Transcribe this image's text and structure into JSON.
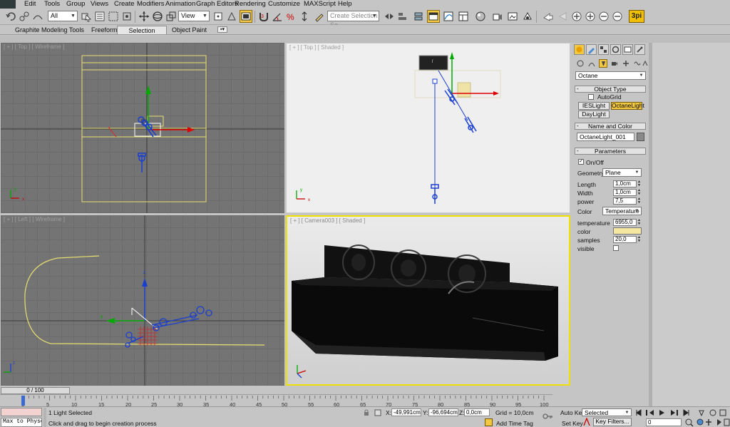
{
  "menu": {
    "items": [
      "Edit",
      "Tools",
      "Group",
      "Views",
      "Create",
      "Modifiers",
      "Animation",
      "Graph Editors",
      "Rendering",
      "Customize",
      "MAXScript",
      "Help"
    ]
  },
  "toolbar": {
    "selection_filter": "All",
    "ref_coord": "View",
    "named_selection_placeholder": "Create Selection Se",
    "logo": "3pi"
  },
  "ribbon": {
    "tabs": [
      "Graphite Modeling Tools",
      "Freeform",
      "Selection",
      "Object Paint"
    ],
    "active_tab": "Selection"
  },
  "viewports": {
    "top_left": "[ + ] [ Top ] [ Wireframe ]",
    "top_right": "[ + ] [ Top ] [ Shaded ]",
    "bottom_left": "[ + ] [ Left ] [ Wireframe ]",
    "bottom_right": "[ + ] [ Camera003 ] [ Shaded ]"
  },
  "command_panel": {
    "category_dropdown": "Octane",
    "object_type": {
      "title": "Object Type",
      "autogrid_label": "AutoGrid",
      "buttons": [
        "IESLight",
        "OctaneLight",
        "DayLight"
      ],
      "active_button": "OctaneLight"
    },
    "name_and_color": {
      "title": "Name and Color",
      "name": "OctaneLight_001"
    },
    "parameters": {
      "title": "Parameters",
      "on_off_label": "On/Off",
      "geometry_label": "Geometry",
      "geometry_value": "Plane",
      "length_label": "Length",
      "length_value": "1,0cm",
      "width_label": "Width",
      "width_value": "1,0cm",
      "power_label": "power",
      "power_value": "7,5",
      "color_label": "Color",
      "color_mode": "Temperature",
      "temperature_label": "temperature",
      "temperature_value": "6955,0",
      "color_swatch_label": "color",
      "color_swatch_hex": "#f5e6a0",
      "samples_label": "samples",
      "samples_value": "20,0",
      "visible_label": "visible"
    }
  },
  "timeline": {
    "frame_display": "0 / 100",
    "ticks": [
      "0",
      "5",
      "10",
      "15",
      "20",
      "25",
      "30",
      "35",
      "40",
      "45",
      "50",
      "55",
      "60",
      "65",
      "70",
      "75",
      "80",
      "85",
      "90",
      "95",
      "100"
    ]
  },
  "status": {
    "maxscript_listener": "Max to Physc",
    "selection_info": "1 Light Selected",
    "prompt": "Click and drag to begin creation process",
    "x_label": "X:",
    "x_value": "-49,991cm",
    "y_label": "Y:",
    "y_value": "-96,694cm",
    "z_label": "Z:",
    "z_value": "0,0cm",
    "grid": "Grid = 10,0cm",
    "add_time_tag": "Add Time Tag",
    "auto_key": "Auto Key",
    "set_key": "Set Key",
    "key_filter_value": "Selected",
    "key_filters": "Key Filters...",
    "frame_value": "0"
  },
  "colors": {
    "accent_active": "#f2c842",
    "viewport_gray": "#747474",
    "camera_border": "#f0e000",
    "gizmo_blue": "#1a3fd0"
  }
}
